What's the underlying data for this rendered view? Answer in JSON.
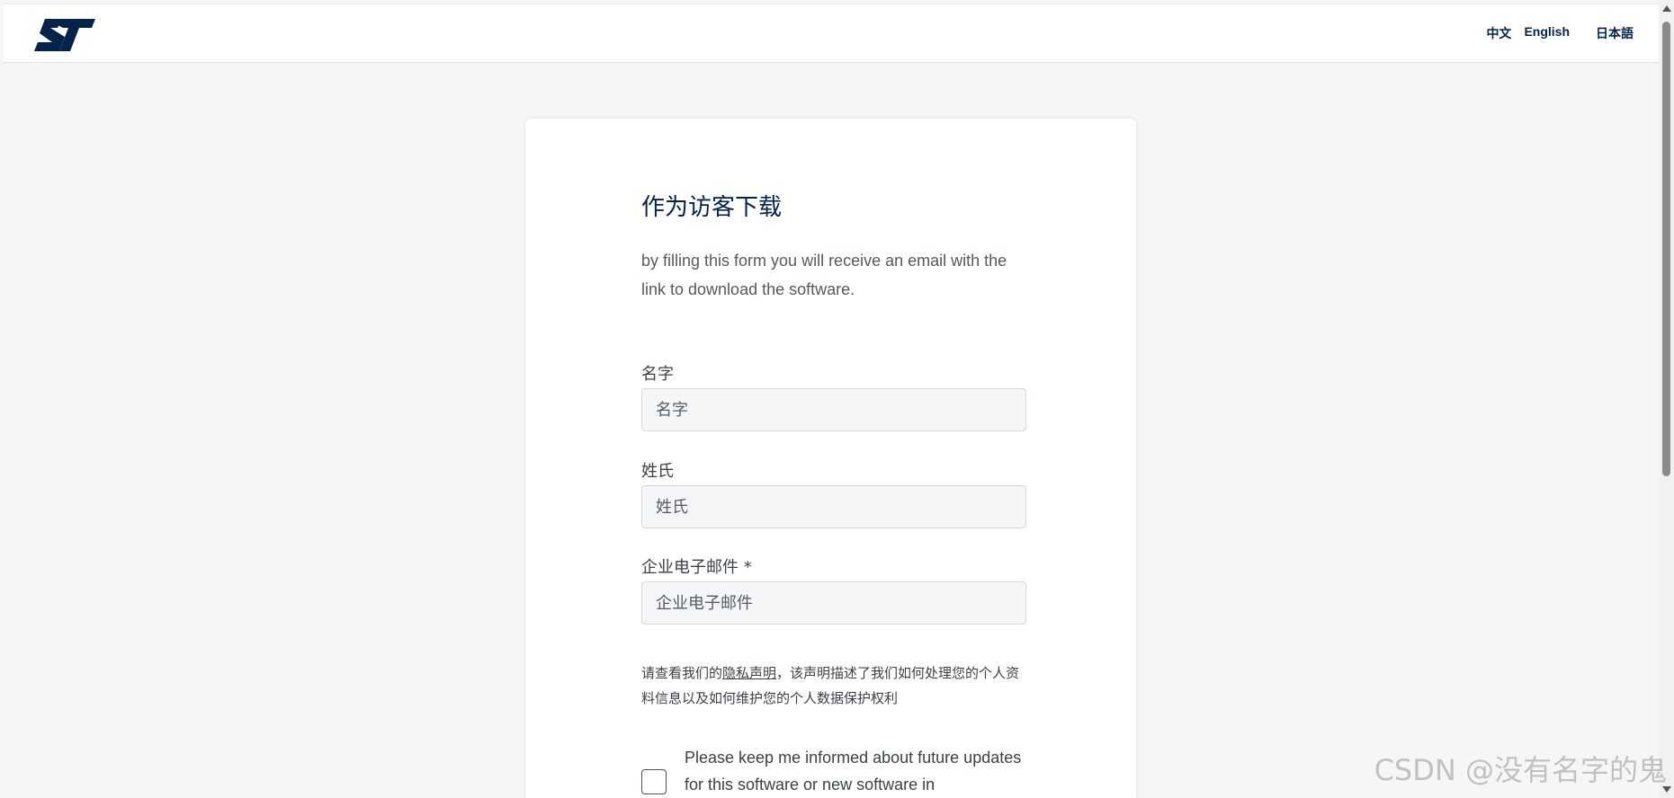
{
  "header": {
    "logo_alt": "ST",
    "languages": [
      "中文",
      "English",
      "日本語"
    ]
  },
  "form": {
    "title": "作为访客下载",
    "intro": "by filling this form you will receive an email with the link to download the software.",
    "fields": [
      {
        "label": "名字",
        "placeholder": "名字"
      },
      {
        "label": "姓氏",
        "placeholder": "姓氏"
      },
      {
        "label": "企业电子邮件 *",
        "placeholder": "企业电子邮件"
      }
    ],
    "privacy": {
      "prefix": "请查看我们的",
      "link": "隐私声明",
      "suffix": "，该声明描述了我们如何处理您的个人资料信息以及如何维护您的个人数据保护权利"
    },
    "checkbox_label": "Please keep me informed about future updates for this software or new software in"
  },
  "watermark": "CSDN @没有名字的鬼",
  "colors": {
    "brand_navy": "#03234b",
    "page_bg": "#f4f6f8",
    "input_bg": "#f4f6f8"
  }
}
